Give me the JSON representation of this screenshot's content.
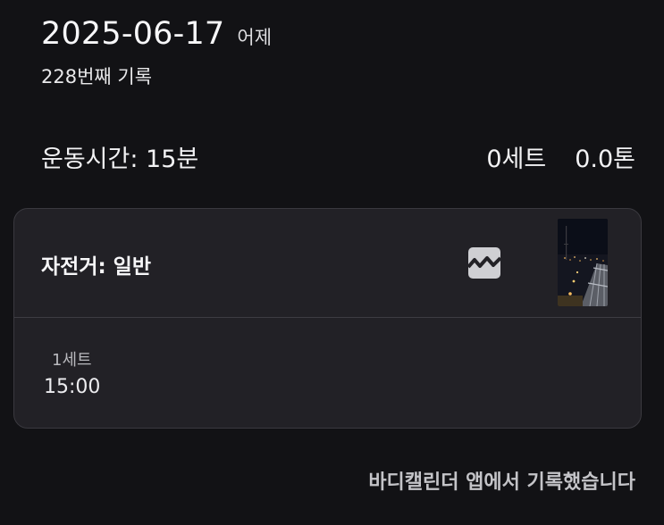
{
  "header": {
    "date": "2025-06-17",
    "relative_day": "어제",
    "record_count": "228번째 기록"
  },
  "stats": {
    "exercise_time": "운동시간: 15분",
    "sets": "0세트",
    "weight": "0.0톤"
  },
  "workout_card": {
    "exercise_name": "자전거: 일반",
    "chart_icon": "line-chart-icon",
    "photo": "night-bridge-photo",
    "sets": [
      {
        "label": "1세트",
        "time": "15:00"
      }
    ]
  },
  "footer": {
    "note": "바디캘린더 앱에서 기록했습니다"
  }
}
